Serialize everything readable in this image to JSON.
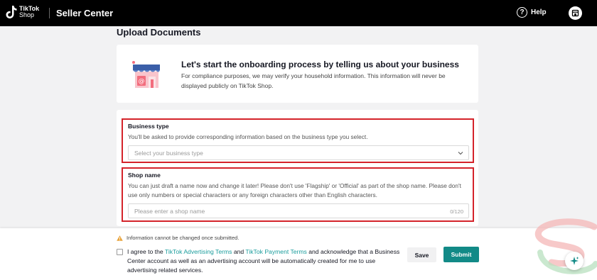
{
  "header": {
    "logo_line1": "TikTok",
    "logo_line2": "Shop",
    "brand": "Seller Center",
    "help_label": "Help",
    "help_icon": "question-circle-icon",
    "store_icon": "store-icon"
  },
  "page": {
    "title": "Upload Documents"
  },
  "intro": {
    "title": "Let's start the onboarding process by telling us about your business",
    "description": "For compliance purposes, we may verify your household information. This information will never be displayed publicly on TikTok Shop.",
    "illustration_icon": "storefront-illustration-icon"
  },
  "form": {
    "business_type": {
      "label": "Business type",
      "help": "You'll be asked to provide corresponding information based on the business type you select.",
      "placeholder": "Select your business type"
    },
    "shop_name": {
      "label": "Shop name",
      "help": "You can just draft a name now and change it later! Please don't use 'Flagship' or 'Official' as part of the shop name. Please don't use only numbers or special characters or any foreign characters other than English characters.",
      "placeholder": "Please enter a shop name",
      "counter": "0/120"
    }
  },
  "footer": {
    "warning": "Information cannot be changed once submitted.",
    "agree_prefix": "I agree to the ",
    "advertising_terms": "TikTok Advertising Terms",
    "and": " and ",
    "payment_terms": "TikTok Payment Terms",
    "agree_suffix": " and acknowledge that a Business Center account as well as an advertising account will be automatically created for me to use advertising related services.",
    "save_label": "Save",
    "submit_label": "Submit"
  },
  "colors": {
    "accent": "#128a87",
    "link": "#1b9d9d",
    "highlight_border": "#d4232a",
    "topbar": "#000000"
  }
}
